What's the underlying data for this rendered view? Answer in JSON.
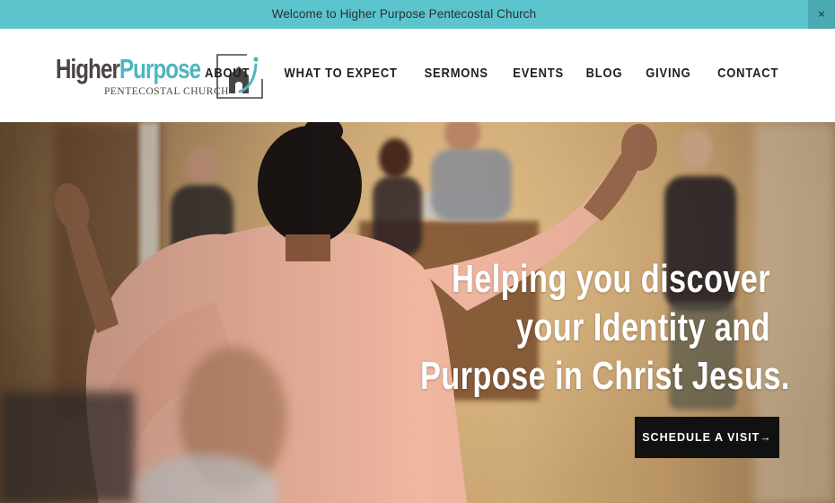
{
  "announcement": {
    "text": "Welcome to Higher Purpose Pentecostal Church",
    "close_label": "×"
  },
  "logo": {
    "word_1": "Higher",
    "word_2": "Purpose",
    "subtitle": "PENTECOSTAL CHURCH",
    "mark_icon": "house-person-icon"
  },
  "nav": {
    "items": [
      "ABOUT",
      "WHAT TO EXPECT",
      "SERMONS",
      "EVENTS",
      "BLOG",
      "GIVING",
      "CONTACT"
    ]
  },
  "hero": {
    "title_lines": [
      "Helping you discover",
      "your Identity and",
      "Purpose in Christ Jesus."
    ],
    "cta_label": "SCHEDULE A VISIT→"
  },
  "colors": {
    "announcement_bg": "#5cc4cd",
    "brand_teal": "#4fb5bf",
    "brand_gray": "#4a4445",
    "cta_bg": "#111111"
  }
}
